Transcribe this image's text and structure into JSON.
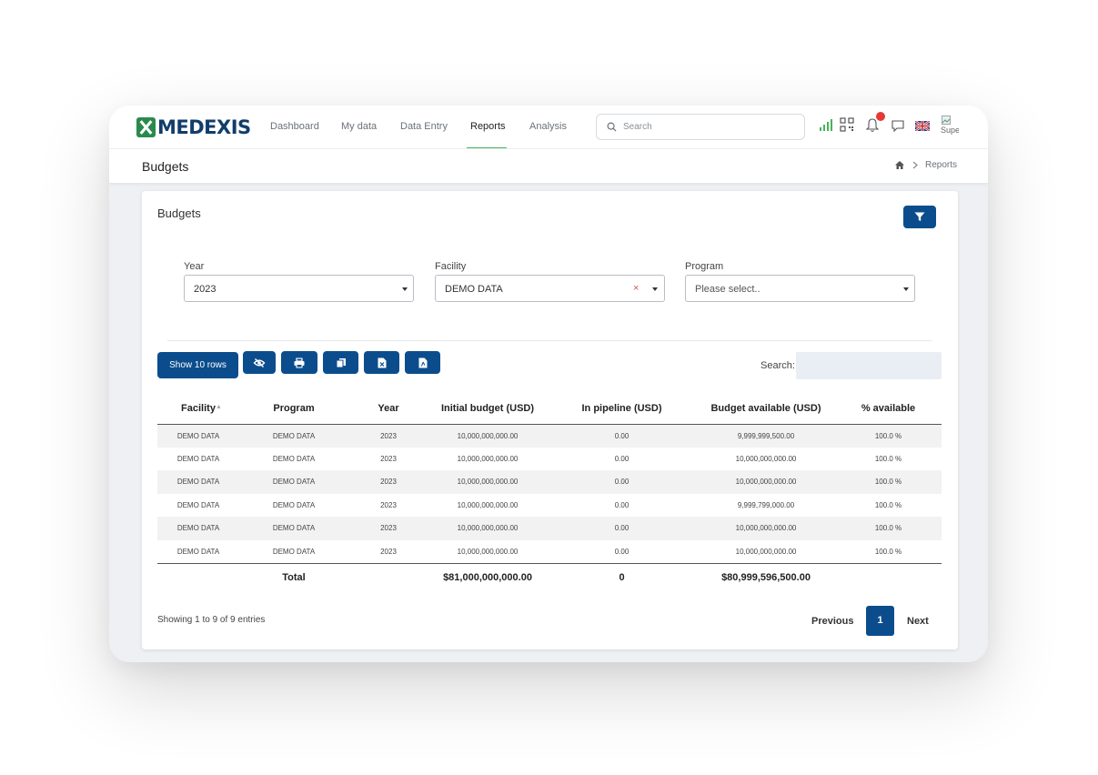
{
  "app": {
    "logo_text": "MEDEXIS"
  },
  "nav": {
    "items": [
      {
        "label": "Dashboard"
      },
      {
        "label": "My data"
      },
      {
        "label": "Data Entry"
      },
      {
        "label": "Reports"
      },
      {
        "label": "Analysis"
      }
    ],
    "active": "Reports"
  },
  "search": {
    "placeholder": "Search"
  },
  "topbar": {
    "icons": [
      "signal-icon",
      "qr-code-icon",
      "bell-icon",
      "chat-icon",
      "uk-flag-icon",
      "avatar"
    ],
    "notification_color": "#e53935",
    "avatar_alt": "Supe"
  },
  "page": {
    "title": "Budgets"
  },
  "breadcrumb": {
    "home_icon": "home-icon",
    "current": "Reports"
  },
  "card": {
    "title": "Budgets"
  },
  "filters": {
    "year": {
      "label": "Year",
      "value": "2023"
    },
    "facility": {
      "label": "Facility",
      "value": "DEMO DATA",
      "clear": "×"
    },
    "program": {
      "label": "Program",
      "placeholder": "Please select.."
    }
  },
  "toolbar": {
    "show_rows_label": "Show 10 rows",
    "buttons": [
      "eye-slash-icon",
      "print-icon",
      "copy-icon",
      "excel-icon",
      "pdf-icon"
    ],
    "search_label": "Search:"
  },
  "table": {
    "headers": [
      "Facility",
      "Program",
      "Year",
      "Initial budget (USD)",
      "In pipeline (USD)",
      "Budget available (USD)",
      "% available"
    ],
    "sort_indicator": "▲",
    "rows": [
      [
        "DEMO DATA",
        "DEMO DATA",
        "2023",
        "10,000,000,000.00",
        "0.00",
        "9,999,999,500.00",
        "100.0 %"
      ],
      [
        "DEMO DATA",
        "DEMO DATA",
        "2023",
        "10,000,000,000.00",
        "0.00",
        "10,000,000,000.00",
        "100.0 %"
      ],
      [
        "DEMO DATA",
        "DEMO DATA",
        "2023",
        "10,000,000,000.00",
        "0.00",
        "10,000,000,000.00",
        "100.0 %"
      ],
      [
        "DEMO DATA",
        "DEMO DATA",
        "2023",
        "10,000,000,000.00",
        "0.00",
        "9,999,799,000.00",
        "100.0 %"
      ],
      [
        "DEMO DATA",
        "DEMO DATA",
        "2023",
        "10,000,000,000.00",
        "0.00",
        "10,000,000,000.00",
        "100.0 %"
      ],
      [
        "DEMO DATA",
        "DEMO DATA",
        "2023",
        "10,000,000,000.00",
        "0.00",
        "10,000,000,000.00",
        "100.0 %"
      ]
    ],
    "footer": [
      "",
      "Total",
      "",
      "$81,000,000,000.00",
      "0",
      "$80,999,596,500.00",
      ""
    ]
  },
  "pagination": {
    "info": "Showing 1 to 9 of 9 entries",
    "previous": "Previous",
    "current_page": "1",
    "next": "Next"
  },
  "colors": {
    "primary": "#0b4d8c",
    "brand_green": "#2a8a4e",
    "nav_active_underline": "#46b45a"
  }
}
